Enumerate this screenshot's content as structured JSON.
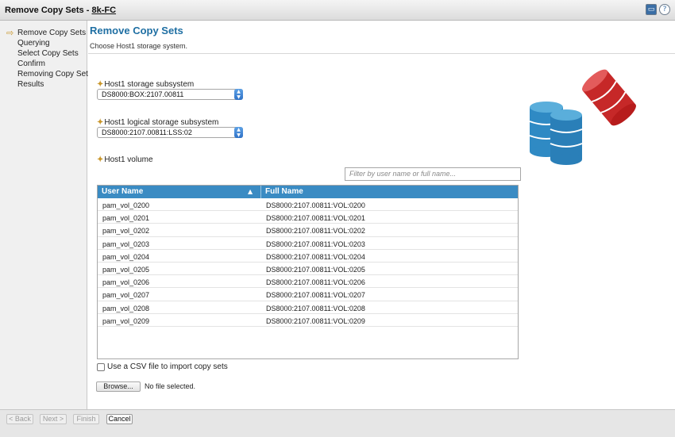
{
  "window": {
    "title": "Remove Copy Sets",
    "separator": "-",
    "host_link": "8k-FC",
    "icons": [
      "monitor-icon",
      "help-icon"
    ]
  },
  "steps": [
    {
      "label": "Remove Copy Sets",
      "current": true
    },
    {
      "label": "Querying",
      "current": false
    },
    {
      "label": "Select Copy Sets",
      "current": false
    },
    {
      "label": "Confirm",
      "current": false
    },
    {
      "label": "Removing Copy Sets",
      "current": false
    },
    {
      "label": "Results",
      "current": false
    }
  ],
  "page": {
    "title": "Remove Copy Sets",
    "subtitle": "Choose Host1 storage system."
  },
  "form": {
    "required_mark": "✦",
    "storage_subsystem_label": "Host1 storage subsystem",
    "storage_subsystem_value": "DS8000:BOX:2107.00811",
    "logical_subsystem_label": "Host1 logical storage subsystem",
    "logical_subsystem_value": "DS8000:2107.00811:LSS:02",
    "volume_label": "Host1 volume",
    "filter_placeholder": "Filter by user name or full name..."
  },
  "table": {
    "columns": [
      "User Name",
      "Full Name"
    ],
    "sort_indicator": "▲",
    "rows": [
      [
        "pam_vol_0200",
        "DS8000:2107.00811:VOL:0200"
      ],
      [
        "pam_vol_0201",
        "DS8000:2107.00811:VOL:0201"
      ],
      [
        "pam_vol_0202",
        "DS8000:2107.00811:VOL:0202"
      ],
      [
        "pam_vol_0203",
        "DS8000:2107.00811:VOL:0203"
      ],
      [
        "pam_vol_0204",
        "DS8000:2107.00811:VOL:0204"
      ],
      [
        "pam_vol_0205",
        "DS8000:2107.00811:VOL:0205"
      ],
      [
        "pam_vol_0206",
        "DS8000:2107.00811:VOL:0206"
      ],
      [
        "pam_vol_0207",
        "DS8000:2107.00811:VOL:0207"
      ],
      [
        "pam_vol_0208",
        "DS8000:2107.00811:VOL:0208"
      ],
      [
        "pam_vol_0209",
        "DS8000:2107.00811:VOL:0209"
      ]
    ]
  },
  "csv": {
    "checkbox_label": "Use a CSV file to import copy sets",
    "checked": false,
    "browse_label": "Browse...",
    "file_status": "No file selected."
  },
  "footer": {
    "back": "< Back",
    "next": "Next >",
    "finish": "Finish",
    "cancel": "Cancel"
  },
  "colors": {
    "accent": "#1f6fa3",
    "table_header": "#3a8bc3",
    "required": "#c9962a",
    "db_blue": "#2f8ac4",
    "db_red": "#c62828"
  }
}
